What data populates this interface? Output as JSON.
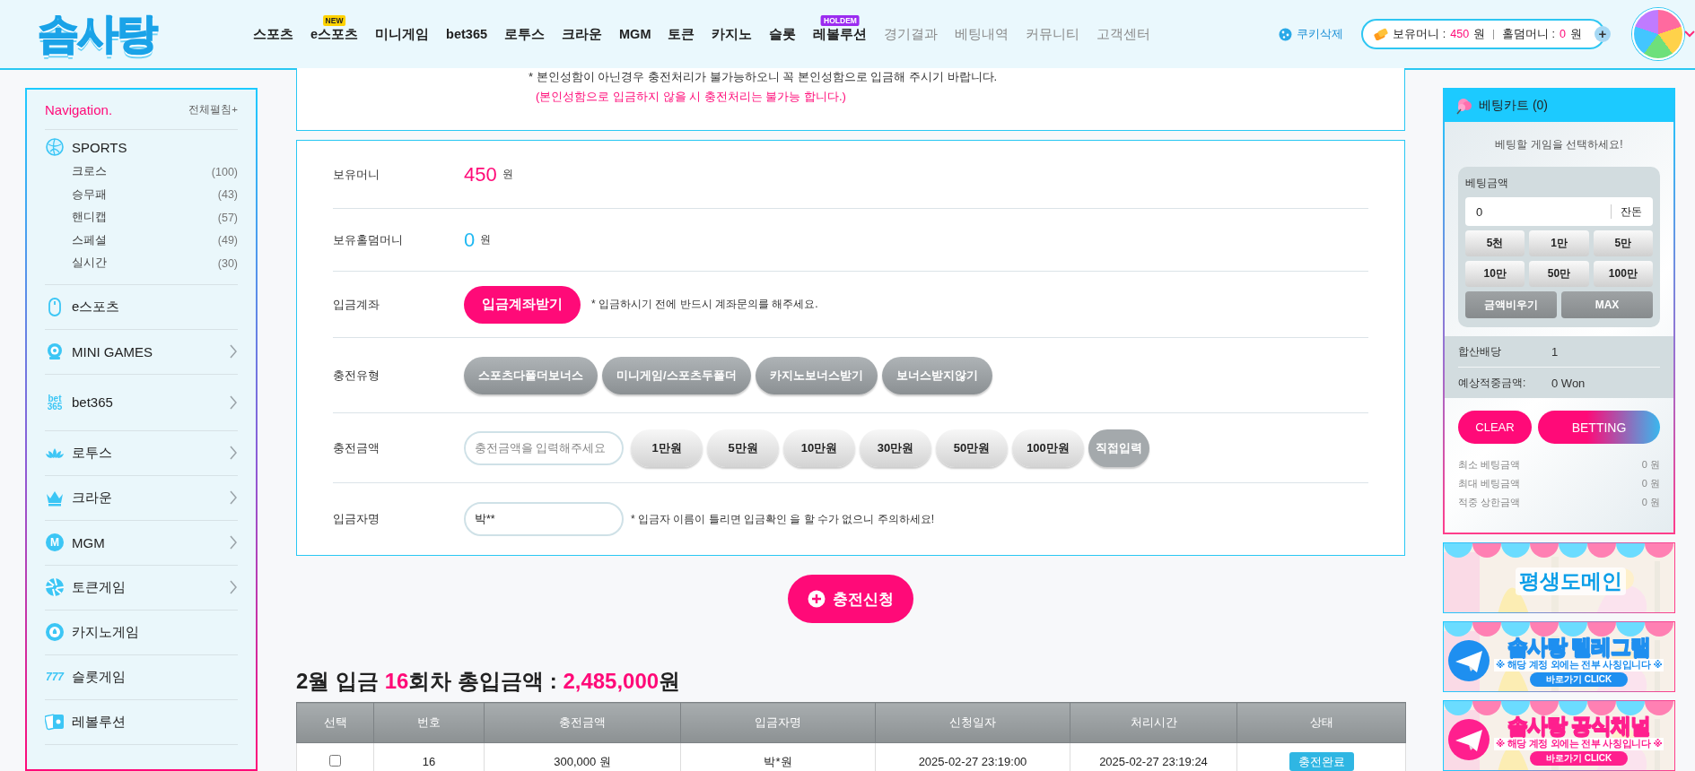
{
  "header": {
    "logo": "솜사탕",
    "nav": [
      {
        "label": "스포츠",
        "muted": false
      },
      {
        "label": "e스포츠",
        "muted": false,
        "badge": {
          "text": "NEW",
          "color": "#ffd200"
        }
      },
      {
        "label": "미니게임",
        "muted": false
      },
      {
        "label": "bet365",
        "muted": false
      },
      {
        "label": "로투스",
        "muted": false
      },
      {
        "label": "크라운",
        "muted": false
      },
      {
        "label": "MGM",
        "muted": false
      },
      {
        "label": "토큰",
        "muted": false
      },
      {
        "label": "카지노",
        "muted": false
      },
      {
        "label": "슬롯",
        "muted": false
      },
      {
        "label": "레볼루션",
        "muted": false,
        "badge": {
          "text": "HOLDEM",
          "color": "#9b2cf0"
        }
      },
      {
        "label": "경기결과",
        "muted": true
      },
      {
        "label": "베팅내역",
        "muted": true
      },
      {
        "label": "커뮤니티",
        "muted": true
      },
      {
        "label": "고객센터",
        "muted": true
      }
    ],
    "cookie_button": "쿠키삭제",
    "wallet": {
      "money_label": "보유머니 :",
      "money": "450",
      "money_unit": "원",
      "holdem_label": "홀덤머니 :",
      "holdem": "0",
      "holdem_unit": "원",
      "plus": "+"
    }
  },
  "sidebar": {
    "title": "Navigation.",
    "expand_all": "전체펼침+",
    "items": [
      {
        "label": "SPORTS",
        "has_submenu": false,
        "children": [
          {
            "label": "크로스",
            "count": "(100)"
          },
          {
            "label": "승무패",
            "count": "(43)"
          },
          {
            "label": "핸디캡",
            "count": "(57)"
          },
          {
            "label": "스페셜",
            "count": "(49)"
          },
          {
            "label": "실시간",
            "count": "(30)"
          }
        ]
      },
      {
        "label": "e스포츠",
        "has_submenu": false
      },
      {
        "label": "MINI GAMES",
        "has_submenu": true
      },
      {
        "label": "bet365",
        "has_submenu": true,
        "icon_text": [
          "bet",
          "365"
        ]
      },
      {
        "label": "로투스",
        "has_submenu": true
      },
      {
        "label": "크라운",
        "has_submenu": true
      },
      {
        "label": "MGM",
        "has_submenu": true,
        "icon_text": [
          "M"
        ]
      },
      {
        "label": "토큰게임",
        "has_submenu": true
      },
      {
        "label": "카지노게임",
        "has_submenu": false
      },
      {
        "label": "슬롯게임",
        "has_submenu": false,
        "icon_text": [
          "777"
        ]
      },
      {
        "label": "레볼루션",
        "has_submenu": false
      }
    ]
  },
  "deposit": {
    "notice": [
      {
        "text": "* 본인성함이 아닌경우 충전처리가 불가능하오니 꼭 본인성함으로 입금해 주시기 바랍니다.",
        "kind": "normal"
      },
      {
        "text": "(본인성함으로 입금하지 않을 시 충전처리는 불가능 합니다.)",
        "kind": "warning"
      }
    ],
    "rows": [
      {
        "kind": "balance",
        "label": "보유머니",
        "value": "450",
        "unit": "원",
        "color": "#ff0a78"
      },
      {
        "kind": "balance",
        "label": "보유홀덤머니",
        "value": "0",
        "unit": "원",
        "color": "#1fb8f2"
      },
      {
        "kind": "action",
        "label": "입금계좌",
        "button": "입금계좌받기",
        "note": "* 입금하시기 전에 반드시 계좌문의를 해주세요."
      },
      {
        "kind": "options",
        "label": "충전유형",
        "options": [
          "스포츠다폴더보너스",
          "미니게임/스포츠두폴더",
          "카지노보너스받기",
          "보너스받지않기"
        ]
      },
      {
        "kind": "amount",
        "label": "충전금액",
        "placeholder": "충전금액을 입력해주세요",
        "options": [
          "1만원",
          "5만원",
          "10만원",
          "30만원",
          "50만원",
          "100만원"
        ],
        "direct": "직접입력"
      },
      {
        "kind": "name",
        "label": "입금자명",
        "value": "박**",
        "note": "* 입금자 이름이 틀리면 입금확인 을 할 수가 없으니 주의하세요!"
      }
    ],
    "submit": "충전신청"
  },
  "history": {
    "summary": [
      {
        "text": "2월 입금 ",
        "highlight": false
      },
      {
        "text": "16",
        "highlight": true
      },
      {
        "text": "회차 총입금액 : ",
        "highlight": false
      },
      {
        "text": "2,485,000",
        "highlight": true
      },
      {
        "text": "원",
        "highlight": false
      }
    ],
    "columns": [
      "선택",
      "번호",
      "충전금액",
      "입금자명",
      "신청일자",
      "처리시간",
      "상태"
    ],
    "rows": [
      {
        "checked": false,
        "cells": [
          "",
          "16",
          "300,000 원",
          "박*원",
          "2025-02-27 23:19:00",
          "2025-02-27 23:19:24"
        ],
        "status": "충전완료"
      }
    ]
  },
  "cart": {
    "title": "베팅카트 (0)",
    "hint": "베팅할 게임을 선택하세요!",
    "amount_label": "베팅금액",
    "amount": "0",
    "change": "잔돈",
    "chips": [
      "5천",
      "1만",
      "5만",
      "10만",
      "50만",
      "100만"
    ],
    "reset": "금액비우기",
    "max": "MAX",
    "summary": [
      {
        "label": "합산배당",
        "value": "1"
      },
      {
        "label": "예상적중금액:",
        "value": "0 Won"
      }
    ],
    "clear": "CLEAR",
    "bet": "BETTING",
    "limits": [
      {
        "label": "최소 베팅금액",
        "value": "0 원"
      },
      {
        "label": "최대 베팅금액",
        "value": "0 원"
      },
      {
        "label": "적중 상한금액",
        "value": "0 원"
      }
    ]
  },
  "banners": [
    {
      "kind": "domain",
      "title": "평생도메인"
    },
    {
      "kind": "channel",
      "title": "솜사탕 텔레그램",
      "sub": "※ 해당 계정 외에는 전부 사칭입니다 ※",
      "cta": "바로가기 CLICK",
      "color": "#1e8ff0"
    },
    {
      "kind": "channel",
      "title": "솜사탕 공식채널",
      "sub": "※ 해당 계정 외에는 전부 사칭입니다 ※",
      "cta": "바로가기 CLICK",
      "color": "#ff1f8e"
    }
  ]
}
